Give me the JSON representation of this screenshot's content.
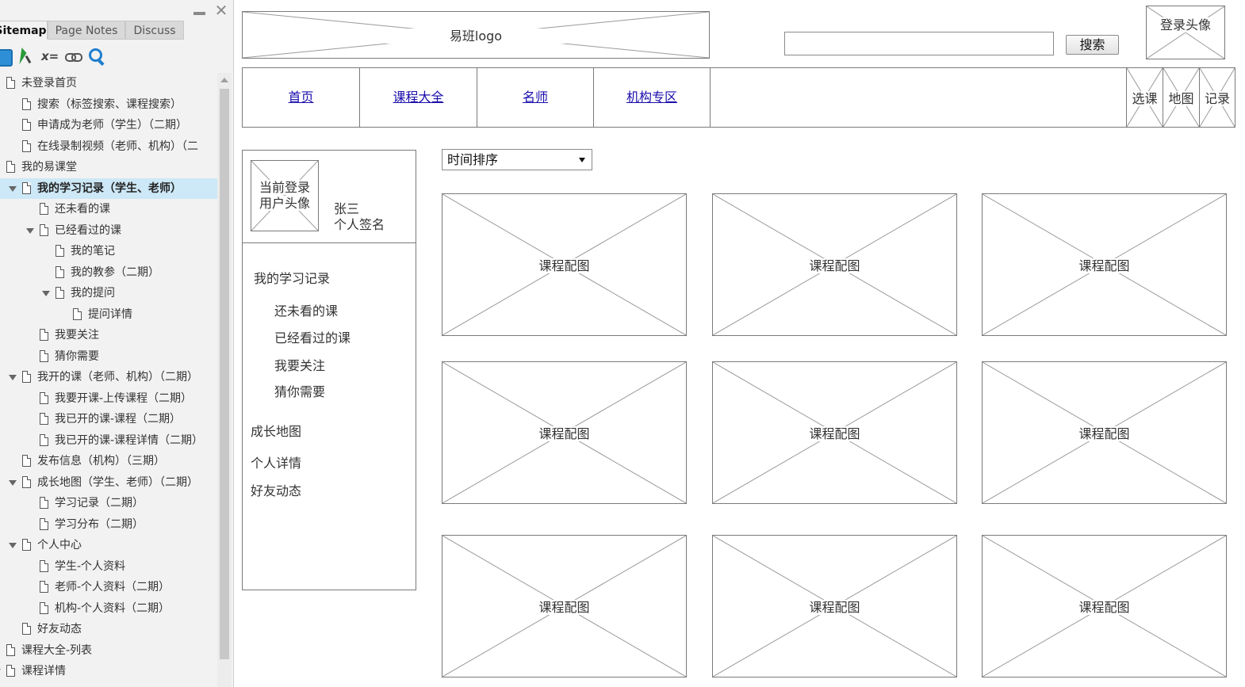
{
  "panel": {
    "tabs": [
      "Sitemap",
      "Page Notes",
      "Discuss"
    ],
    "toolbar_variables": "x=",
    "tree": [
      {
        "label": "未登录首页",
        "level": 0,
        "caret": false
      },
      {
        "label": "搜索（标签搜索、课程搜索）",
        "level": 1,
        "caret": false
      },
      {
        "label": "申请成为老师（学生）（二期）",
        "level": 1,
        "caret": false
      },
      {
        "label": "在线录制视频（老师、机构）（二",
        "level": 1,
        "caret": false
      },
      {
        "label": "我的易课堂",
        "level": 0,
        "caret": false
      },
      {
        "label": "我的学习记录（学生、老师）",
        "level": 1,
        "caret": true,
        "selected": true
      },
      {
        "label": "还未看的课",
        "level": 2,
        "caret": false
      },
      {
        "label": "已经看过的课",
        "level": 2,
        "caret": true
      },
      {
        "label": "我的笔记",
        "level": 3,
        "caret": false
      },
      {
        "label": "我的教参（二期）",
        "level": 3,
        "caret": false
      },
      {
        "label": "我的提问",
        "level": 3,
        "caret": true
      },
      {
        "label": "提问详情",
        "level": 4,
        "caret": false
      },
      {
        "label": "我要关注",
        "level": 2,
        "caret": false
      },
      {
        "label": "猜你需要",
        "level": 2,
        "caret": false
      },
      {
        "label": "我开的课（老师、机构）（二期）",
        "level": 1,
        "caret": true
      },
      {
        "label": "我要开课-上传课程（二期）",
        "level": 2,
        "caret": false
      },
      {
        "label": "我已开的课-课程（二期）",
        "level": 2,
        "caret": false
      },
      {
        "label": "我已开的课-课程详情（二期）",
        "level": 2,
        "caret": false
      },
      {
        "label": "发布信息（机构）（三期）",
        "level": 1,
        "caret": false
      },
      {
        "label": "成长地图（学生、老师）（二期）",
        "level": 1,
        "caret": true
      },
      {
        "label": "学习记录（二期）",
        "level": 2,
        "caret": false
      },
      {
        "label": "学习分布（二期）",
        "level": 2,
        "caret": false
      },
      {
        "label": "个人中心",
        "level": 1,
        "caret": true
      },
      {
        "label": "学生-个人资料",
        "level": 2,
        "caret": false
      },
      {
        "label": "老师-个人资料（二期）",
        "level": 2,
        "caret": false
      },
      {
        "label": "机构-个人资料（二期）",
        "level": 2,
        "caret": false
      },
      {
        "label": "好友动态",
        "level": 1,
        "caret": false
      },
      {
        "label": "课程大全-列表",
        "level": 0,
        "caret": false
      },
      {
        "label": "课程详情",
        "level": 0,
        "caret": true
      }
    ]
  },
  "header": {
    "logo": "易班logo",
    "search_button": "搜索",
    "login_avatar": "登录头像"
  },
  "nav": {
    "links": [
      "首页",
      "课程大全",
      "名师",
      "机构专区"
    ],
    "right_boxes": [
      "选课",
      "地图",
      "记录"
    ]
  },
  "user": {
    "avatar_line1": "当前登录",
    "avatar_line2": "用户头像",
    "name": "张三",
    "signature": "个人签名",
    "menu_title": "我的学习记录",
    "submenu": [
      "还未看的课",
      "已经看过的课",
      "我要关注",
      "猜你需要"
    ],
    "links": [
      "成长地图",
      "个人详情",
      "好友动态"
    ]
  },
  "sort": {
    "selected": "时间排序"
  },
  "course_image_label": "课程配图",
  "course_count": 9
}
